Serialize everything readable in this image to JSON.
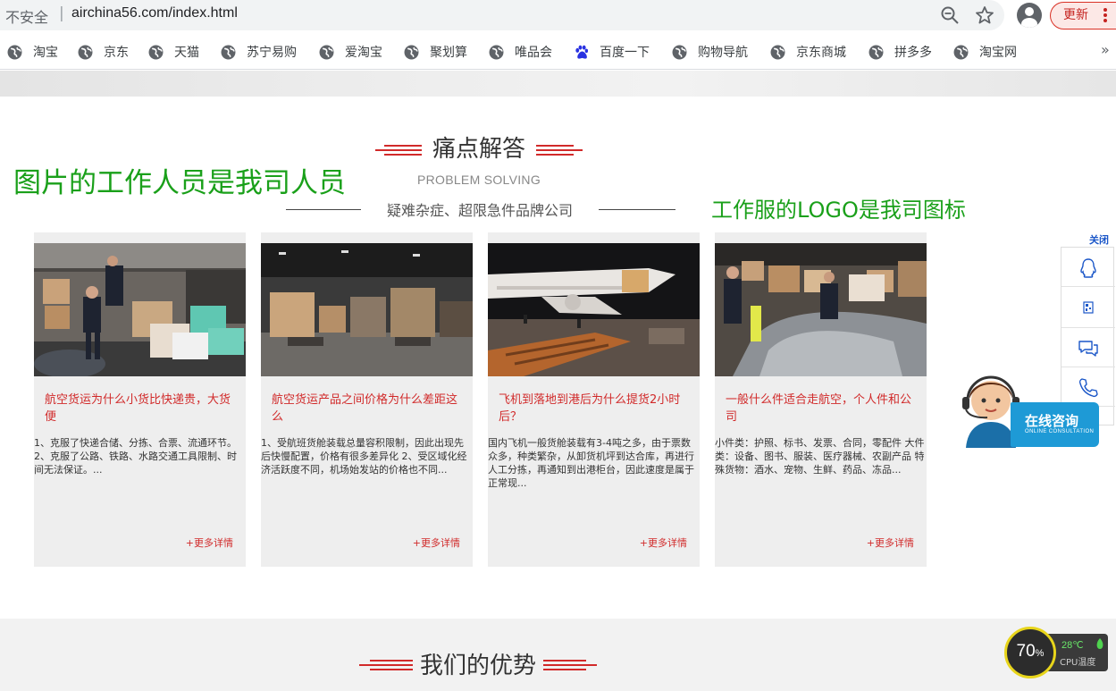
{
  "browser": {
    "insecure_label": "不安全",
    "separator": "|",
    "url": "airchina56.com/index.html",
    "update_label": "更新",
    "bookmarks_overflow": "»",
    "bookmarks": [
      {
        "label": "淘宝",
        "icon": "globe-icon"
      },
      {
        "label": "京东",
        "icon": "globe-icon"
      },
      {
        "label": "天猫",
        "icon": "globe-icon"
      },
      {
        "label": "苏宁易购",
        "icon": "globe-icon"
      },
      {
        "label": "爱淘宝",
        "icon": "globe-icon"
      },
      {
        "label": "聚划算",
        "icon": "globe-icon"
      },
      {
        "label": "唯品会",
        "icon": "globe-icon"
      },
      {
        "label": "百度一下",
        "icon": "baidu-paw-icon"
      },
      {
        "label": "购物导航",
        "icon": "globe-icon"
      },
      {
        "label": "京东商城",
        "icon": "globe-icon"
      },
      {
        "label": "拼多多",
        "icon": "globe-icon"
      },
      {
        "label": "淘宝网",
        "icon": "globe-icon"
      }
    ]
  },
  "section": {
    "title": "痛点解答",
    "subtitle": "PROBLEM SOLVING",
    "description": "疑难杂症、超限急件品牌公司"
  },
  "annotations": {
    "left": "图片的工作人员是我司人员",
    "right": "工作服的LOGO是我司图标"
  },
  "cards": [
    {
      "title": "航空货运为什么小货比快递贵，大货便",
      "body": "1、克服了快递合储、分拣、合票、流通环节。 2、克服了公路、铁路、水路交通工具限制、时间无法保证。...",
      "more": "+更多详情"
    },
    {
      "title": "航空货运产品之间价格为什么差距这么",
      "body": "1、受航班货舱装载总量容积限制，因此出现先后快慢配置，价格有很多差异化 2、受区域化经济活跃度不同，机场始发站的价格也不同...",
      "more": "+更多详情"
    },
    {
      "title": "飞机到落地到港后为什么提货2小时后？",
      "body": "国内飞机一般货舱装载有3-4吨之多，由于票数众多，种类繁杂，从卸货机坪到达合库，再进行人工分拣，再通知到出港柜台，因此速度是属于正常现...",
      "more": "+更多详情"
    },
    {
      "title": "一般什么件适合走航空，个人件和公司",
      "body": "小件类：护照、标书、发票、合同，零配件 大件类：设备、图书、服装、医疗器械、农副产品 特殊货物：酒水、宠物、生鲜、药品、冻品...",
      "more": "+更多详情"
    }
  ],
  "sidebar": {
    "close_label": "关闭",
    "items": [
      "qq-icon",
      "qrcode-icon",
      "chat-icon",
      "phone-icon"
    ]
  },
  "consult": {
    "title": "在线咨询",
    "subtitle": "ONLINE CONSULTATION"
  },
  "section2": {
    "title": "我们的优势"
  },
  "cpu_widget": {
    "percent": "70",
    "percent_unit": "%",
    "temperature": "28℃",
    "label": "CPU温度",
    "ring_color": "#e8d51b"
  },
  "colors": {
    "accent_red": "#d12a2a",
    "annotation_green": "#1aa01a",
    "consult_blue": "#1e9ad6"
  }
}
